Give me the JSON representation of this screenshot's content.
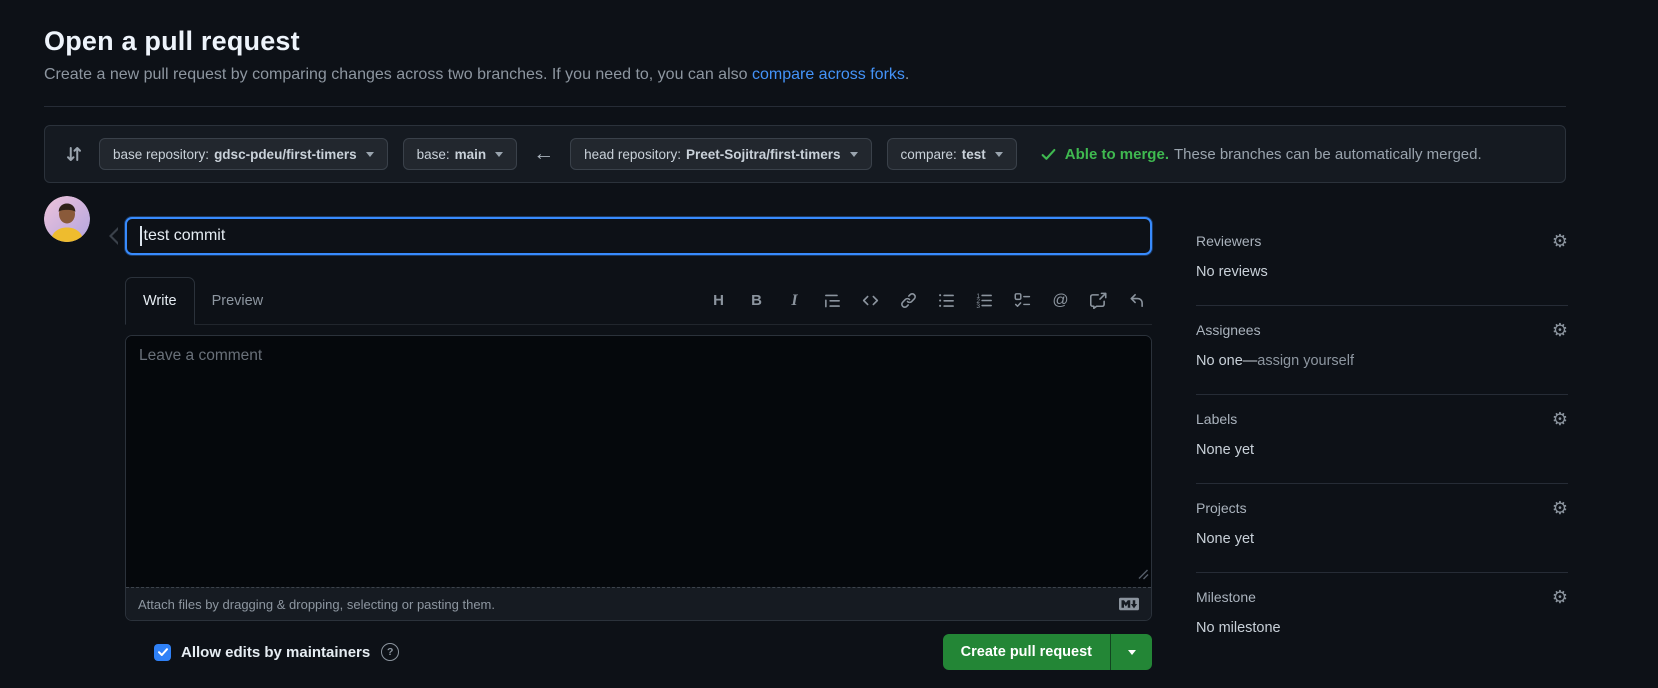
{
  "page": {
    "title": "Open a pull request",
    "subtitle_before_link": "Create a new pull request by comparing changes across two branches. If you need to, you can also ",
    "subtitle_link": "compare across forks",
    "subtitle_after_link": "."
  },
  "branch_bar": {
    "base_repo_label": "base repository:",
    "base_repo_value": "gdsc-pdeu/first-timers",
    "base_label": "base:",
    "base_value": "main",
    "arrow_glyph": "←",
    "head_repo_label": "head repository:",
    "head_repo_value": "Preet-Sojitra/first-timers",
    "compare_label": "compare:",
    "compare_value": "test",
    "merge_status_bold": "Able to merge.",
    "merge_status_rest": "These branches can be automatically merged."
  },
  "form": {
    "title_value": "test commit",
    "tabs": [
      {
        "label": "Write",
        "active": true
      },
      {
        "label": "Preview",
        "active": false
      }
    ],
    "toolbar": {
      "heading_glyph": "H",
      "bold_glyph": "B",
      "italic_glyph": "I",
      "mention_glyph": "@",
      "icons": [
        "heading",
        "bold",
        "italic",
        "quote",
        "code",
        "link",
        "list-unordered",
        "list-ordered",
        "tasklist",
        "mention",
        "cross-reference",
        "saved-reply"
      ]
    },
    "comment_placeholder": "Leave a comment",
    "attach_hint": "Attach files by dragging & dropping, selecting or pasting them.",
    "allow_edits_label": "Allow edits by maintainers",
    "allow_edits_checked": true,
    "question_glyph": "?",
    "create_button_label": "Create pull request"
  },
  "sidebar": {
    "gear_glyph": "⚙",
    "sections": [
      {
        "label": "Reviewers",
        "value": "No reviews"
      },
      {
        "label": "Assignees",
        "value": "No one—",
        "link": "assign yourself"
      },
      {
        "label": "Labels",
        "value": "None yet"
      },
      {
        "label": "Projects",
        "value": "None yet"
      },
      {
        "label": "Milestone",
        "value": "No milestone"
      }
    ]
  },
  "colors": {
    "page_bg": "#0d1117",
    "success_green": "#3fb950",
    "button_green": "#238636",
    "link_blue": "#4493f8",
    "focus_blue": "#388bfd",
    "checkbox_blue": "#2f81f7"
  }
}
